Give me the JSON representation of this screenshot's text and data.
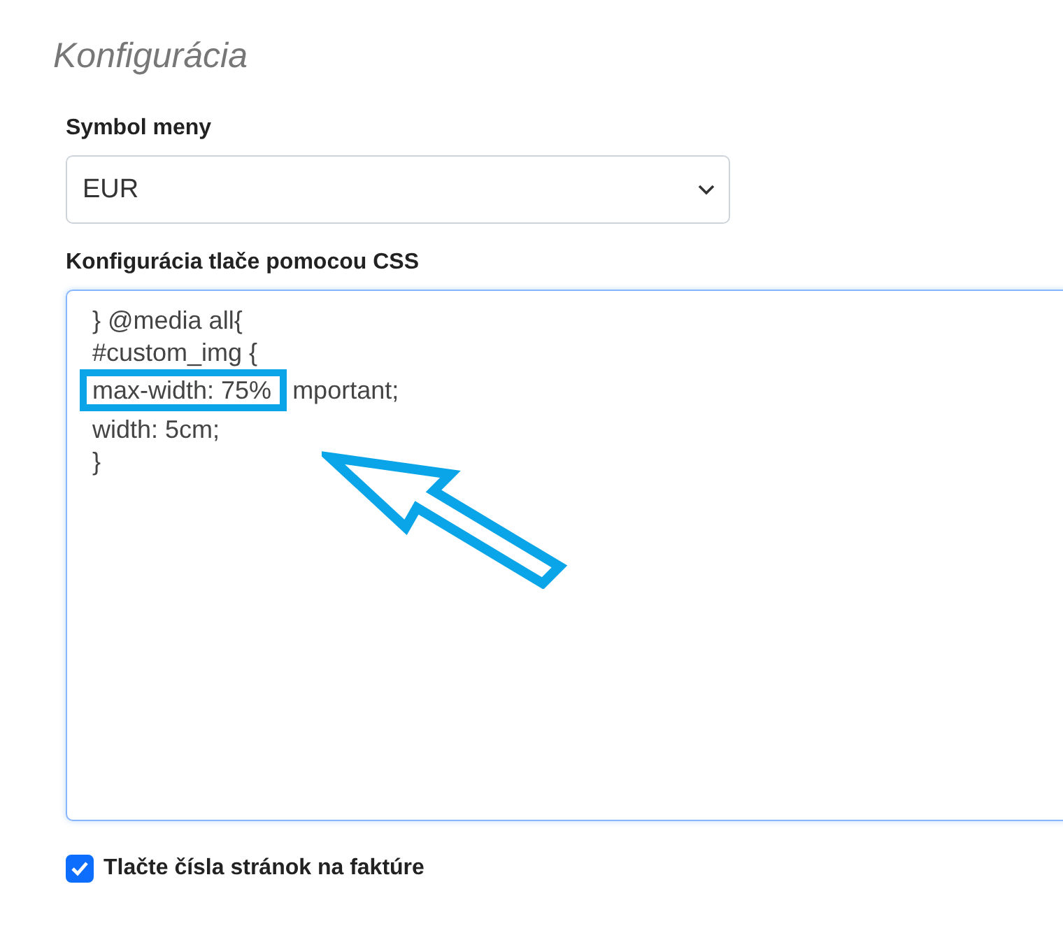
{
  "title": "Konfigurácia",
  "currency": {
    "label": "Symbol meny",
    "value": "EUR"
  },
  "css_config": {
    "label": "Konfigurácia tlače pomocou CSS",
    "lines": [
      {
        "text": "} @media all{"
      },
      {
        "text": "#custom_img {"
      },
      {
        "highlight": "max-width: 75%",
        "text": "mportant;"
      },
      {
        "text": "width: 5cm;"
      },
      {
        "text": "}"
      }
    ]
  },
  "page_numbers": {
    "label": "Tlačte čísla stránok na faktúre",
    "checked": true
  }
}
